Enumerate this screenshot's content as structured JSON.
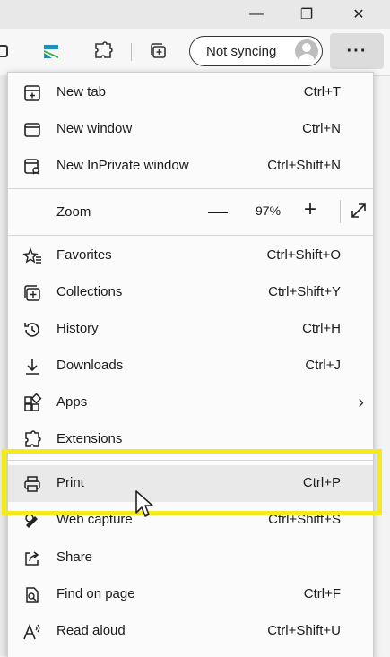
{
  "window": {
    "minimize_glyph": "—",
    "restore_glyph": "❐",
    "close_glyph": "✕"
  },
  "toolbar": {
    "sync_label": "Not syncing",
    "more_label": "···",
    "icons": [
      "tab-actions-icon",
      "extension-icon",
      "extensions-puzzle-icon",
      "collections-icon"
    ]
  },
  "menu": {
    "new_tab": {
      "label": "New tab",
      "shortcut": "Ctrl+T"
    },
    "new_window": {
      "label": "New window",
      "shortcut": "Ctrl+N"
    },
    "new_inprivate": {
      "label": "New InPrivate window",
      "shortcut": "Ctrl+Shift+N"
    },
    "zoom": {
      "label": "Zoom",
      "minus": "—",
      "value": "97%",
      "plus": "+"
    },
    "favorites": {
      "label": "Favorites",
      "shortcut": "Ctrl+Shift+O"
    },
    "collections": {
      "label": "Collections",
      "shortcut": "Ctrl+Shift+Y"
    },
    "history": {
      "label": "History",
      "shortcut": "Ctrl+H"
    },
    "downloads": {
      "label": "Downloads",
      "shortcut": "Ctrl+J"
    },
    "apps": {
      "label": "Apps",
      "chevron": "›"
    },
    "extensions": {
      "label": "Extensions"
    },
    "print": {
      "label": "Print",
      "shortcut": "Ctrl+P"
    },
    "web_capture": {
      "label": "Web capture",
      "shortcut": "Ctrl+Shift+S"
    },
    "share": {
      "label": "Share"
    },
    "find_on_page": {
      "label": "Find on page",
      "shortcut": "Ctrl+F"
    },
    "read_aloud": {
      "label": "Read aloud",
      "shortcut": "Ctrl+Shift+U"
    }
  },
  "colors": {
    "highlight": "#f5ea1a",
    "hover": "#e9e9e9",
    "menu_bg": "#fbfbfb"
  }
}
